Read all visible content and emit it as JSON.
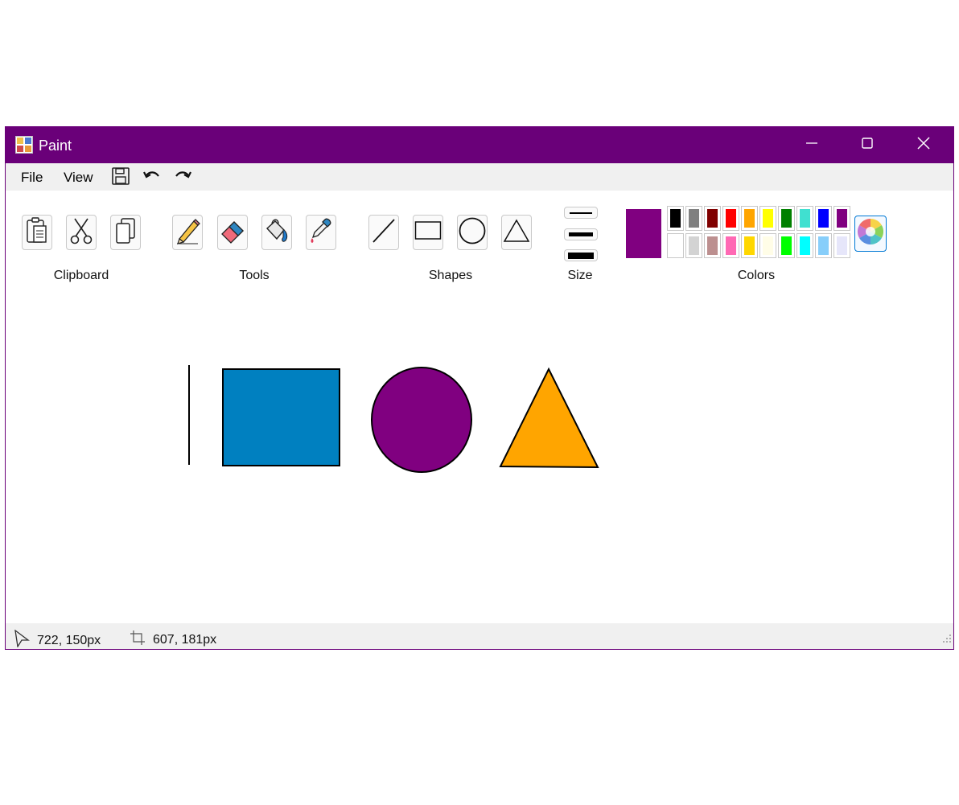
{
  "window": {
    "title": "Paint",
    "titlebar_color": "#6a0079"
  },
  "icons": {
    "app": "paint-palette-icon",
    "minimize": "minimize-icon",
    "maximize": "maximize-icon",
    "close": "close-icon",
    "save": "save-icon",
    "undo": "undo-icon",
    "redo": "redo-icon",
    "paste": "paste-icon",
    "cut": "scissors-icon",
    "copy": "copy-icon",
    "pencil": "pencil-icon",
    "eraser": "eraser-icon",
    "fill": "paint-bucket-icon",
    "picker": "eyedropper-icon",
    "line": "line-icon",
    "rectangle": "rectangle-icon",
    "circle": "circle-icon",
    "triangle": "triangle-icon",
    "edit_colors": "color-wheel-icon",
    "cursor": "cursor-icon",
    "selection": "selection-size-icon",
    "grip": "resize-grip-icon"
  },
  "menu": {
    "file": "File",
    "view": "View"
  },
  "ribbon": {
    "clipboard_label": "Clipboard",
    "tools_label": "Tools",
    "shapes_label": "Shapes",
    "size_label": "Size",
    "colors_label": "Colors"
  },
  "colors": {
    "current": "#800080",
    "row1": [
      "#000000",
      "#808080",
      "#800000",
      "#ff0000",
      "#ffa500",
      "#ffff00",
      "#008000",
      "#40e0d0",
      "#0000ff",
      "#800080"
    ],
    "row2": [
      "#ffffff",
      "#d3d3d3",
      "#bc8f8f",
      "#ff69b4",
      "#ffd700",
      "#fffde7",
      "#00ff00",
      "#00ffff",
      "#87cefa",
      "#e6e6fa"
    ]
  },
  "canvas_shapes": {
    "line_color": "#000000",
    "rectangle_fill": "#0080c0",
    "circle_fill": "#800080",
    "triangle_fill": "#ffa500"
  },
  "status": {
    "cursor_position": "722, 150px",
    "selection_size": "607, 181px"
  }
}
